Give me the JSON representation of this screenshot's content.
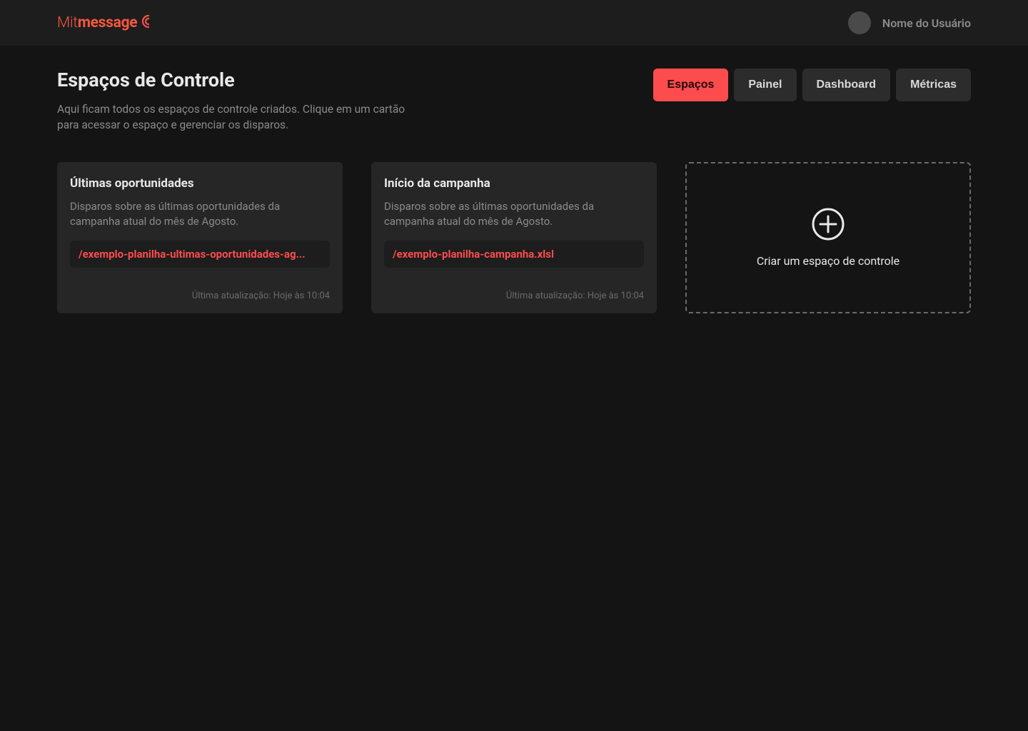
{
  "header": {
    "logo_part1": "Mit",
    "logo_part2": "message",
    "username": "Nome do Usuário"
  },
  "page": {
    "title": "Espaços de Controle",
    "subtitle": "Aqui ficam todos os espaços de controle criados. Clique em um cartão para acessar o espaço e gerenciar os disparos."
  },
  "nav": {
    "tabs": [
      {
        "label": "Espaços",
        "active": true
      },
      {
        "label": "Painel",
        "active": false
      },
      {
        "label": "Dashboard",
        "active": false
      },
      {
        "label": "Métricas",
        "active": false
      }
    ]
  },
  "cards": [
    {
      "title": "Últimas oportunidades",
      "description": "Disparos sobre as últimas oportunidades da campanha atual do mês de Agosto.",
      "file": "/exemplo-planilha-ultimas-oportunidades-ag...",
      "updated": "Última atualização: Hoje às 10:04"
    },
    {
      "title": "Início da campanha",
      "description": "Disparos sobre as últimas oportunidades da campanha atual do mês de Agosto.",
      "file": "/exemplo-planilha-campanha.xlsl",
      "updated": "Última atualização: Hoje às 10:04"
    }
  ],
  "create": {
    "label": "Criar um espaço de controle"
  }
}
